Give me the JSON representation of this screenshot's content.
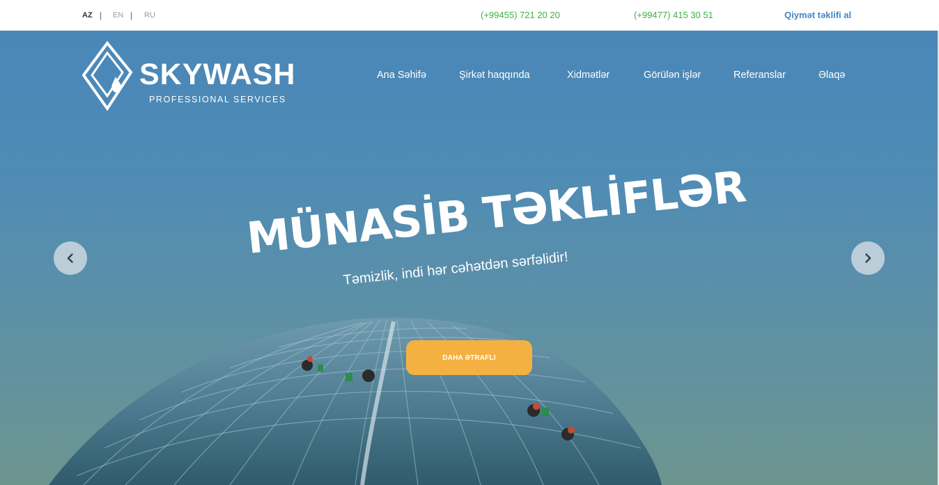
{
  "topbar": {
    "languages": [
      {
        "code": "AZ",
        "active": true
      },
      {
        "code": "EN",
        "active": false
      },
      {
        "code": "RU",
        "active": false
      }
    ],
    "separator": "|",
    "phones": [
      "(+99455) 721 20 20",
      "(+99477) 415 30 51"
    ],
    "quote_link": "Qiymət təklifi al"
  },
  "logo": {
    "name": "SKYWASH",
    "tagline": "PROFESSIONAL SERVICES"
  },
  "nav": {
    "items": [
      "Ana Səhifə",
      "Şirkət haqqında",
      "Xidmətlər",
      "Görülən işlər",
      "Referanslar",
      "Əlaqə"
    ]
  },
  "hero": {
    "headline": "MÜNASİB TƏKLİFLƏR",
    "subline": "Təmizlik, indi hər cəhətdən sərfəlidir!",
    "cta_label": "DAHA ƏTRAFLI",
    "prev_icon": "chevron-left-icon",
    "next_icon": "chevron-right-icon"
  },
  "colors": {
    "phone": "#3fae48",
    "quote_link": "#3f86c8",
    "cta": "#f4b141"
  }
}
